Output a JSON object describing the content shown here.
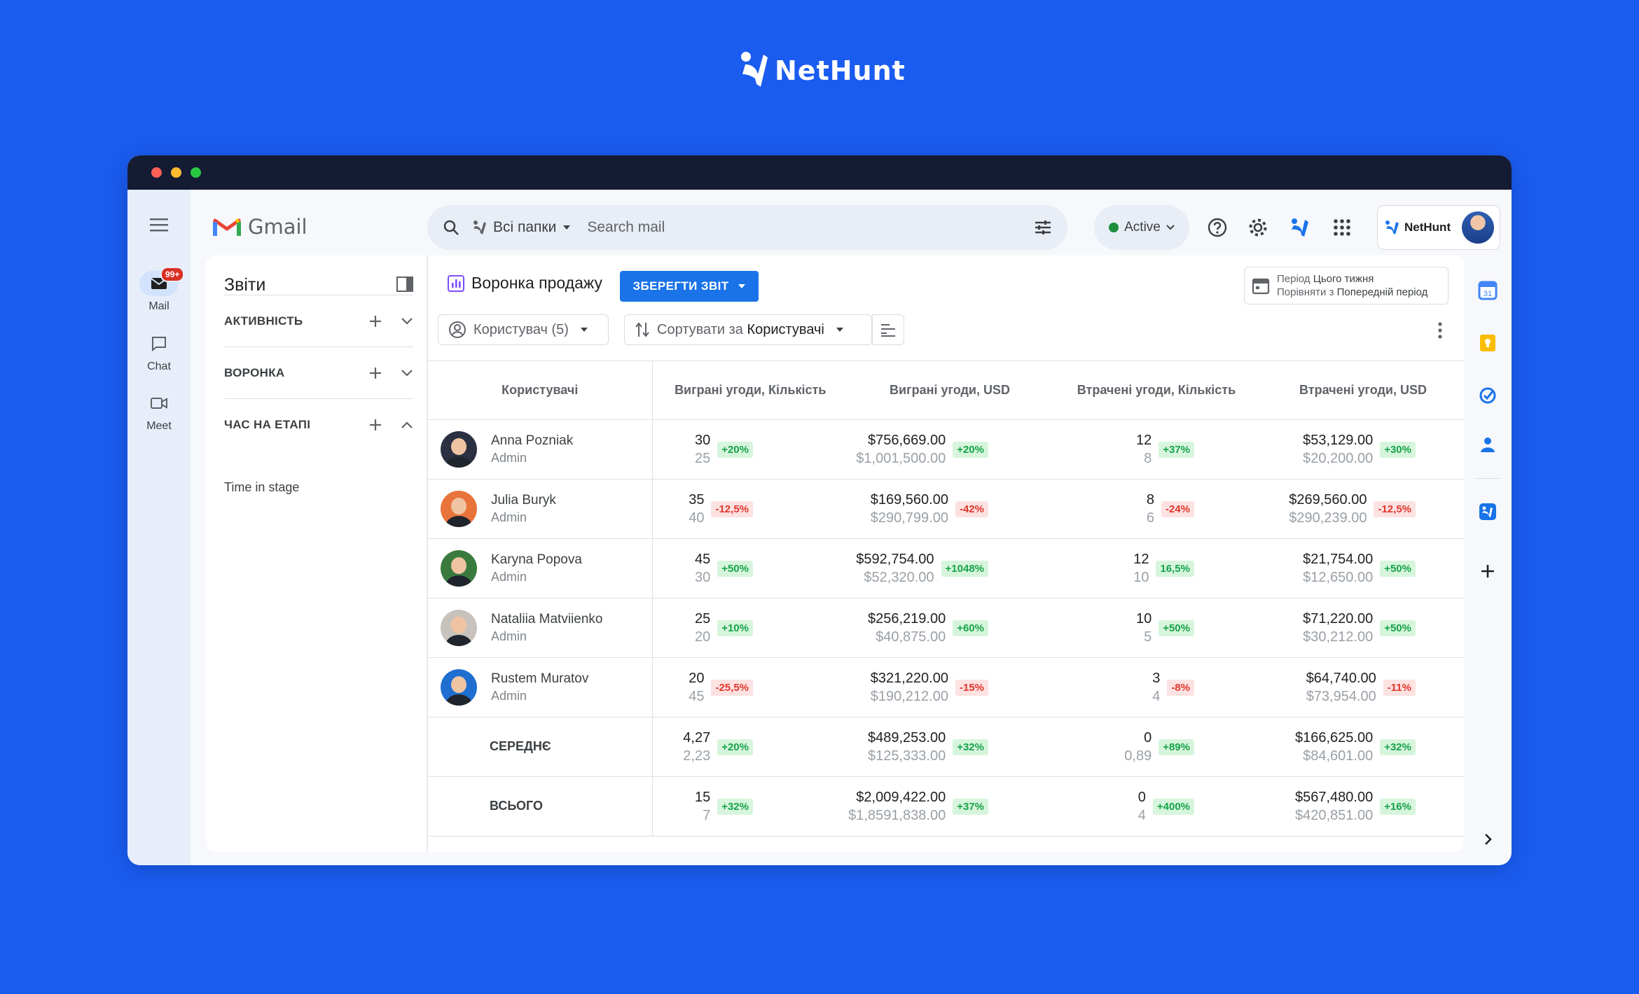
{
  "brand": {
    "name": "NetHunt"
  },
  "window": {
    "dots": [
      "#ff5f57",
      "#febc2e",
      "#28c840"
    ]
  },
  "gmail": {
    "logo_text": "Gmail",
    "rail": [
      {
        "label": "Mail",
        "badge": "99+",
        "icon": "mail-icon",
        "active": true
      },
      {
        "label": "Chat",
        "icon": "chat-icon",
        "active": false
      },
      {
        "label": "Meet",
        "icon": "meet-icon",
        "active": false
      }
    ],
    "search": {
      "folder": "Всі папки",
      "placeholder": "Search mail"
    },
    "status": "Active",
    "nethunt_chip": "NetHunt"
  },
  "sidebar": {
    "title": "Звіти",
    "sections": [
      {
        "label": "АКТИВНІСТЬ",
        "expanded": false
      },
      {
        "label": "ВОРОНКА",
        "expanded": false
      },
      {
        "label": "ЧАС НА ЕТАПІ",
        "expanded": true
      }
    ],
    "subitem": "Time in stage"
  },
  "report": {
    "title": "Воронка продажу",
    "save_label": "ЗБЕРЕГТИ ЗВІТ",
    "period_prefix": "Період",
    "period_value": "Цього тижня",
    "compare_prefix": "Порівняти з",
    "compare_value": "Попередній період",
    "filter_user": "Користувач (5)",
    "sort_prefix": "Сортувати за",
    "sort_value": "Користувачі"
  },
  "table": {
    "headers": [
      "Користувачі",
      "Виграні угоди, Кількість",
      "Виграні угоди, USD",
      "Втрачені угоди, Кількість",
      "Втрачені угоди, USD"
    ],
    "rows": [
      {
        "name": "Anna Pozniak",
        "role": "Admin",
        "avatar": "#2b3142",
        "cells": [
          [
            "30",
            "25",
            "+20%",
            "pos"
          ],
          [
            "$756,669.00",
            "$1,001,500.00",
            "+20%",
            "pos"
          ],
          [
            "12",
            "8",
            "+37%",
            "pos"
          ],
          [
            "$53,129.00",
            "$20,200.00",
            "+30%",
            "pos"
          ]
        ]
      },
      {
        "name": "Julia Buryk",
        "role": "Admin",
        "avatar": "#e8743b",
        "cells": [
          [
            "35",
            "40",
            "-12,5%",
            "neg"
          ],
          [
            "$169,560.00",
            "$290,799.00",
            "-42%",
            "neg"
          ],
          [
            "8",
            "6",
            "-24%",
            "neg"
          ],
          [
            "$269,560.00",
            "$290,239.00",
            "-12,5%",
            "neg"
          ]
        ]
      },
      {
        "name": "Karyna Popova",
        "role": "Admin",
        "avatar": "#3a7a3e",
        "cells": [
          [
            "45",
            "30",
            "+50%",
            "pos"
          ],
          [
            "$592,754.00",
            "$52,320.00",
            "+1048%",
            "pos"
          ],
          [
            "12",
            "10",
            "16,5%",
            "pos"
          ],
          [
            "$21,754.00",
            "$12,650.00",
            "+50%",
            "pos"
          ]
        ]
      },
      {
        "name": "Nataliia Matviienko",
        "role": "Admin",
        "avatar": "#c7c2bb",
        "cells": [
          [
            "25",
            "20",
            "+10%",
            "pos"
          ],
          [
            "$256,219.00",
            "$40,875.00",
            "+60%",
            "pos"
          ],
          [
            "10",
            "5",
            "+50%",
            "pos"
          ],
          [
            "$71,220.00",
            "$30,212.00",
            "+50%",
            "pos"
          ]
        ]
      },
      {
        "name": "Rustem Muratov",
        "role": "Admin",
        "avatar": "#1f6fd1",
        "cells": [
          [
            "20",
            "45",
            "-25,5%",
            "neg"
          ],
          [
            "$321,220.00",
            "$190,212.00",
            "-15%",
            "neg"
          ],
          [
            "3",
            "4",
            "-8%",
            "neg"
          ],
          [
            "$64,740.00",
            "$73,954.00",
            "-11%",
            "neg"
          ]
        ]
      }
    ],
    "aggregates": [
      {
        "label": "СЕРЕДНЄ",
        "cells": [
          [
            "4,27",
            "2,23",
            "+20%",
            "pos"
          ],
          [
            "$489,253.00",
            "$125,333.00",
            "+32%",
            "pos"
          ],
          [
            "0",
            "0,89",
            "+89%",
            "pos"
          ],
          [
            "$166,625.00",
            "$84,601.00",
            "+32%",
            "pos"
          ]
        ]
      },
      {
        "label": "ВСЬОГО",
        "cells": [
          [
            "15",
            "7",
            "+32%",
            "pos"
          ],
          [
            "$2,009,422.00",
            "$1,8591,838.00",
            "+37%",
            "pos"
          ],
          [
            "0",
            "4",
            "+400%",
            "pos"
          ],
          [
            "$567,480.00",
            "$420,851.00",
            "+16%",
            "pos"
          ]
        ]
      }
    ]
  },
  "addons": [
    "calendar-icon",
    "keep-icon",
    "tasks-icon",
    "contacts-icon",
    "nethunt-icon",
    "add-icon",
    "expand-icon"
  ]
}
